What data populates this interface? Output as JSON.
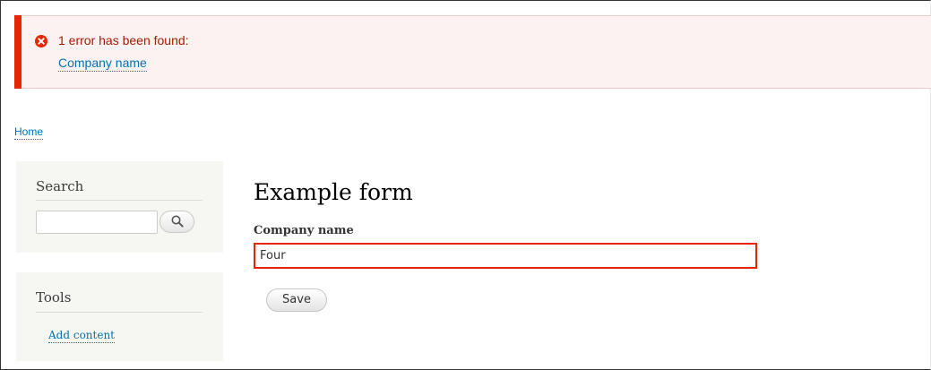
{
  "messages": {
    "error_heading": "1 error has been found:",
    "error_link": "Company name",
    "error_color": "#e62600",
    "error_icon": "error-circle-x"
  },
  "breadcrumb": {
    "home": "Home"
  },
  "sidebar": {
    "search": {
      "title": "Search",
      "input_value": "",
      "button_icon": "magnifier"
    },
    "tools": {
      "title": "Tools",
      "items": [
        {
          "label": "Add content"
        }
      ]
    }
  },
  "main": {
    "title": "Example form",
    "field": {
      "label": "Company name",
      "value": "Four",
      "state": "error"
    },
    "save_label": "Save"
  },
  "colors": {
    "link": "#0071b3",
    "error_background": "#fcf2f1",
    "sidebar_background": "#f6f6f2"
  }
}
